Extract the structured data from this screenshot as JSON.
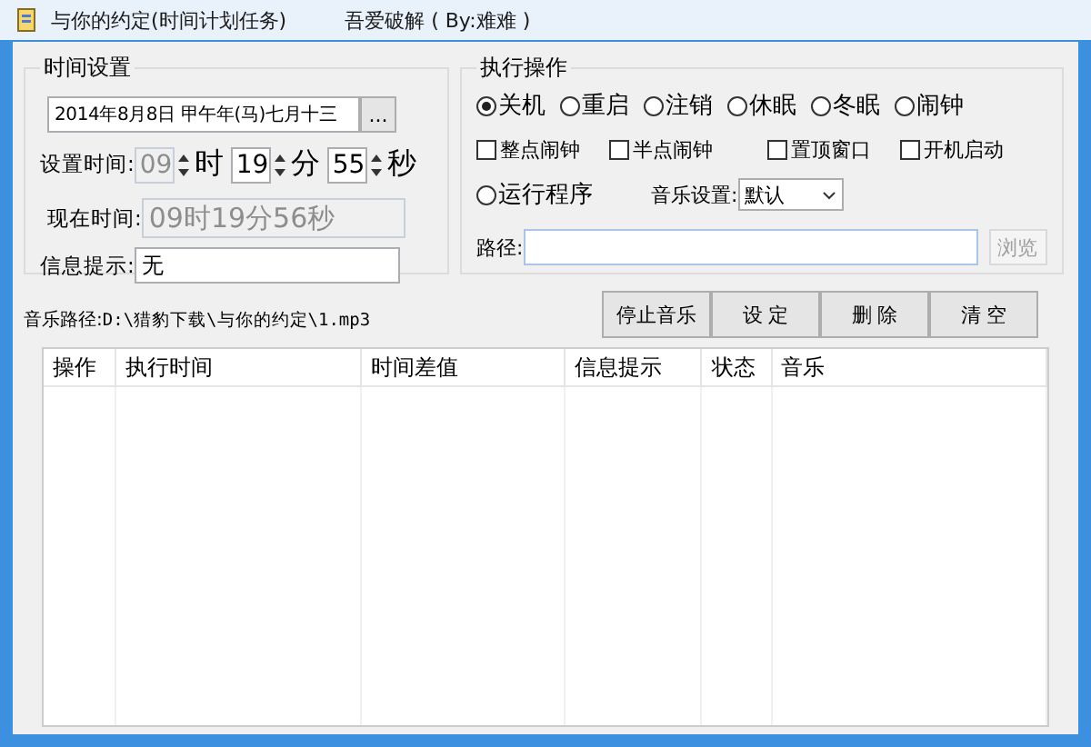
{
  "window": {
    "title": "与你的约定(时间计划任务)",
    "subtitle": "吾爱破解 ( By:难难 )"
  },
  "time_group": {
    "title": "时间设置",
    "date_field": {
      "value": "2014年8月8日  甲午年(马)七月十三",
      "button": "..."
    },
    "set_time": {
      "label": "设置时间:",
      "fields": [
        {
          "value": "09",
          "unit": "时",
          "disabled": true
        },
        {
          "value": "19",
          "unit": "分",
          "disabled": false
        },
        {
          "value": "55",
          "unit": "秒",
          "disabled": false
        }
      ]
    },
    "current_time": {
      "label": "现在时间:",
      "value": "09时19分56秒"
    },
    "info": {
      "label": "信息提示:",
      "value": "无"
    }
  },
  "action_group": {
    "title": "执行操作",
    "radios": [
      {
        "label": "关机",
        "selected": true
      },
      {
        "label": "重启",
        "selected": false
      },
      {
        "label": "注销",
        "selected": false
      },
      {
        "label": "休眠",
        "selected": false
      },
      {
        "label": "冬眠",
        "selected": false
      },
      {
        "label": "闹钟",
        "selected": false
      }
    ],
    "checkboxes": [
      {
        "label": "整点闹钟",
        "checked": false
      },
      {
        "label": "半点闹钟",
        "checked": false
      },
      {
        "label": "置顶窗口",
        "checked": false
      },
      {
        "label": "开机启动",
        "checked": false
      }
    ],
    "run_program": {
      "label": "运行程序",
      "selected": false
    },
    "music_setting": {
      "label": "音乐设置:",
      "value": "默认"
    },
    "path": {
      "label": "路径:"
    },
    "browse": {
      "label": "浏览",
      "disabled": true
    }
  },
  "music_path": {
    "label": "音乐路径:",
    "value": "D:\\猎豹下载\\与你的约定\\1.mp3"
  },
  "buttons": [
    "停止音乐",
    "设 定",
    "删 除",
    "清 空"
  ],
  "table": {
    "columns": [
      "操作",
      "执行时间",
      "时间差值",
      "信息提示",
      "状态",
      "音乐"
    ]
  }
}
